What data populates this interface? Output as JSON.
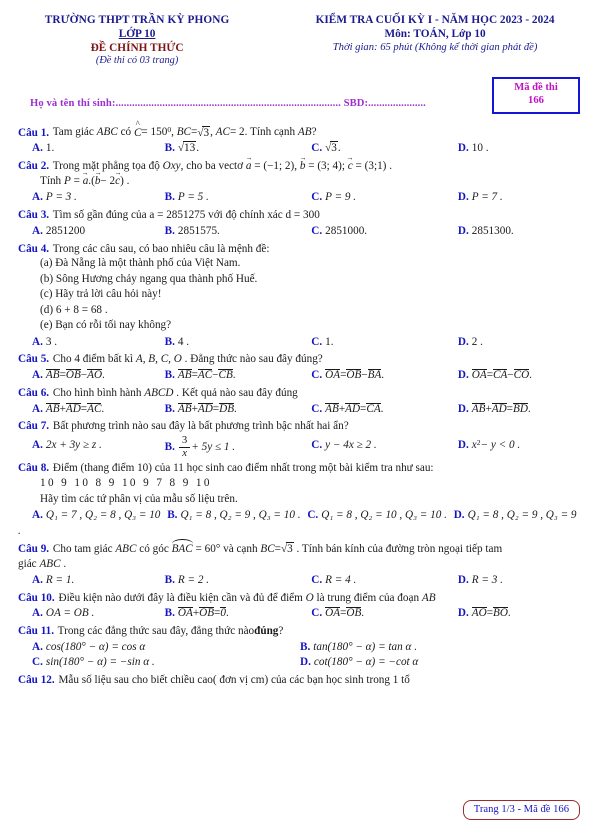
{
  "header": {
    "school": "TRƯỜNG THPT TRẦN KỲ PHONG",
    "grade": "LỚP 10",
    "official": "ĐỀ CHÍNH THỨC",
    "pages_note": "(Đề thi có 03 trang)",
    "exam_title": "KIỂM TRA CUỐI KỲ I - NĂM HỌC 2023 - 2024",
    "subject": "Môn: TOÁN, Lớp 10",
    "time": "Thời gian: 65 phút (Không kể thời gian phát đề)",
    "candidate_line": "Họ và tên thí sinh:.................................................................................. SBD:.....................",
    "code_label": "Mã đề thi",
    "code_value": "166"
  },
  "questions": {
    "q1": {
      "label": "Câu 1.",
      "stem_a": "Tam giác",
      "stem_abc": "ABC",
      "stem_b": "có",
      "angle_c": "C",
      "eq1": "= 150",
      "deg": "0",
      "comma1": ",",
      "bc": "BC",
      "eq2": "=",
      "r3": "3",
      "comma2": ",",
      "ac": "AC",
      "eq3": "= 2. Tính cạnh",
      "ab": "AB",
      "q": "?",
      "opt_a_key": "A.",
      "opt_a_val": "1.",
      "opt_b_key": "B.",
      "opt_b_rad": "13",
      "opt_b_tail": ".",
      "opt_c_key": "C.",
      "opt_c_rad": "3",
      "opt_c_tail": ".",
      "opt_d_key": "D.",
      "opt_d_val": "10 ."
    },
    "q2": {
      "label": "Câu 2.",
      "stem_1": "Trong mặt phẳng tọa độ",
      "oxy": "Oxy",
      "stem_2": ", cho ba vectơ",
      "a": "a",
      "a_val": "= (−1; 2),",
      "b": "b",
      "b_val": "= (3; 4);",
      "c": "c",
      "c_val": "= (3;1) .",
      "line2_pre": "Tính",
      "p": "P",
      "p_eq": "=",
      "p_a": "a",
      "p_dot": ".",
      "p_open": "(",
      "p_b": "b",
      "p_minus": "− 2",
      "p_c": "c",
      "p_close": ") .",
      "opt_a_key": "A.",
      "opt_a_val": "P = 3 .",
      "opt_b_key": "B.",
      "opt_b_val": "P = 5 .",
      "opt_c_key": "C.",
      "opt_c_val": "P = 9 .",
      "opt_d_key": "D.",
      "opt_d_val": "P = 7 ."
    },
    "q3": {
      "label": "Câu 3.",
      "stem": "Tìm số gần đúng của a = 2851275 với độ chính xác d = 300",
      "opt_a_key": "A.",
      "opt_a_val": "2851200",
      "opt_b_key": "B.",
      "opt_b_val": "2851575.",
      "opt_c_key": "C.",
      "opt_c_val": "2851000.",
      "opt_d_key": "D.",
      "opt_d_val": "2851300."
    },
    "q4": {
      "label": "Câu 4.",
      "stem": "Trong các câu sau, có bao nhiêu câu là mệnh đề:",
      "item_a": "(a) Đà Nẵng là một thành phố của Việt Nam.",
      "item_b": "(b) Sông Hương chảy ngang qua thành phố Huế.",
      "item_c": "(c) Hãy trả lời câu hỏi này!",
      "item_d": "(d) 6 + 8 = 68 .",
      "item_e": "(e) Bạn có rỗi tối nay không?",
      "opt_a_key": "A.",
      "opt_a_val": "3 .",
      "opt_b_key": "B.",
      "opt_b_val": "4 .",
      "opt_c_key": "C.",
      "opt_c_val": "1.",
      "opt_d_key": "D.",
      "opt_d_val": "2 ."
    },
    "q5": {
      "label": "Câu 5.",
      "stem_1": "Cho 4 điểm bất kì",
      "points": "A, B, C, O",
      "stem_2": ". Đẳng thức nào sau đây đúng?",
      "opt_a_key": "A.",
      "opt_a_1": "AB",
      "opt_a_eq": "=",
      "opt_a_2": "OB",
      "opt_a_op": "−",
      "opt_a_3": "AO",
      "opt_a_end": ".",
      "opt_b_key": "B.",
      "opt_b_1": "AB",
      "opt_b_eq": "=",
      "opt_b_2": "AC",
      "opt_b_op": "−",
      "opt_b_3": "CB",
      "opt_b_end": ".",
      "opt_c_key": "C.",
      "opt_c_1": "OA",
      "opt_c_eq": "=",
      "opt_c_2": "OB",
      "opt_c_op": "−",
      "opt_c_3": "BA",
      "opt_c_end": ".",
      "opt_d_key": "D.",
      "opt_d_1": "OA",
      "opt_d_eq": "=",
      "opt_d_2": "CA",
      "opt_d_op": "−",
      "opt_d_3": "CO",
      "opt_d_end": "."
    },
    "q6": {
      "label": "Câu 6.",
      "stem_1": "Cho hình bình hành",
      "abcd": "ABCD",
      "stem_2": ". Kết quả nào sau đây đúng",
      "opt_a_key": "A.",
      "opt_a_1": "AB",
      "opt_a_op": "+",
      "opt_a_2": "AD",
      "opt_a_eq": "=",
      "opt_a_3": "AC",
      "opt_a_end": ".",
      "opt_b_key": "B.",
      "opt_b_1": "AB",
      "opt_b_op": "+",
      "opt_b_2": "AD",
      "opt_b_eq": "=",
      "opt_b_3": "DB",
      "opt_b_end": ".",
      "opt_c_key": "C.",
      "opt_c_1": "AB",
      "opt_c_op": "+",
      "opt_c_2": "AD",
      "opt_c_eq": "=",
      "opt_c_3": "CA",
      "opt_c_end": ".",
      "opt_d_key": "D.",
      "opt_d_1": "AB",
      "opt_d_op": "+",
      "opt_d_2": "AD",
      "opt_d_eq": "=",
      "opt_d_3": "BD",
      "opt_d_end": "."
    },
    "q7": {
      "label": "Câu 7.",
      "stem": "Bất phương trình nào sau đây là bất phương trình bậc nhất hai ẩn?",
      "opt_a_key": "A.",
      "opt_a_val": "2x + 3y ≥ z .",
      "opt_b_key": "B.",
      "opt_b_num": "3",
      "opt_b_den": "x",
      "opt_b_tail": "+ 5y ≤ 1 .",
      "opt_c_key": "C.",
      "opt_c_val": "y − 4x ≥ 2 .",
      "opt_d_key": "D.",
      "opt_d_base": "x",
      "opt_d_sup": "2",
      "opt_d_tail": "− y < 0 ."
    },
    "q8": {
      "label": "Câu 8.",
      "stem": "Điểm (thang điểm 10) của 11 học sinh cao điểm nhất trong một bài kiểm tra như sau:",
      "data": "10   9   10   8   9   10   9   7   8   9   10",
      "ask": "Hãy tìm các tứ phân vị của mẫu số liệu trên.",
      "opt_a_key": "A.",
      "opt_a_val": "Q₁ = 7 , Q₂ = 8 , Q₃ = 10",
      "opt_b_key": "B.",
      "opt_b_val": "Q₁ = 8 , Q₂ = 9 , Q₃ = 10 .",
      "opt_c_key": "C.",
      "opt_c_val": "Q₁ = 8 , Q₂ = 10 , Q₃ = 10 .",
      "opt_d_key": "D.",
      "opt_d_val": "Q₁ = 8 , Q₂ = 9 , Q₃ = 9 ."
    },
    "q9": {
      "label": "Câu 9.",
      "stem_1": "Cho tam giác",
      "abc": "ABC",
      "stem_2": "có góc",
      "angle": "BAC",
      "stem_3": "= 60° và cạnh",
      "bc": "BC",
      "stem_4": "=",
      "rad": "3",
      "stem_5": ". Tính bán kính của đường tròn ngoại tiếp tam",
      "line2_1": "giác",
      "line2_abc": "ABC",
      "line2_2": ".",
      "opt_a_key": "A.",
      "opt_a_val": "R = 1.",
      "opt_b_key": "B.",
      "opt_b_val": "R = 2 .",
      "opt_c_key": "C.",
      "opt_c_val": "R = 4 .",
      "opt_d_key": "D.",
      "opt_d_val": "R = 3 ."
    },
    "q10": {
      "label": "Câu 10.",
      "stem_1": "Điều kiện nào dưới đây là điều kiện cần và đủ để điểm",
      "o": "O",
      "stem_2": "là trung điểm của đoạn",
      "ab": "AB",
      "opt_a_key": "A.",
      "opt_a_val": "OA = OB .",
      "opt_b_key": "B.",
      "opt_b_1": "OA",
      "opt_b_op": "+",
      "opt_b_2": "OB",
      "opt_b_eq": "=",
      "opt_b_3": "0",
      "opt_b_end": ".",
      "opt_c_key": "C.",
      "opt_c_1": "OA",
      "opt_c_eq": "=",
      "opt_c_2": "OB",
      "opt_c_end": ".",
      "opt_d_key": "D.",
      "opt_d_1": "AO",
      "opt_d_eq": "=",
      "opt_d_2": "BO",
      "opt_d_end": "."
    },
    "q11": {
      "label": "Câu 11.",
      "stem_1": "Trong các đẳng thức sau đây, đẳng thức nào",
      "stem_bold": "đúng",
      "stem_2": "?",
      "opt_a_key": "A.",
      "opt_a_val": "cos(180° − α) = cos α",
      "opt_b_key": "B.",
      "opt_b_val": "tan(180° − α) = tan α .",
      "opt_c_key": "C.",
      "opt_c_val": "sin(180° − α) = −sin α .",
      "opt_d_key": "D.",
      "opt_d_val": "cot(180° − α) = −cot α"
    },
    "q12": {
      "label": "Câu 12.",
      "stem": "Mẫu số liệu sau cho biết chiều cao( đơn vị cm) của các bạn học sinh trong 1 tổ"
    }
  },
  "footer": {
    "page_info": "Trang 1/3 - Mã đề 166"
  }
}
